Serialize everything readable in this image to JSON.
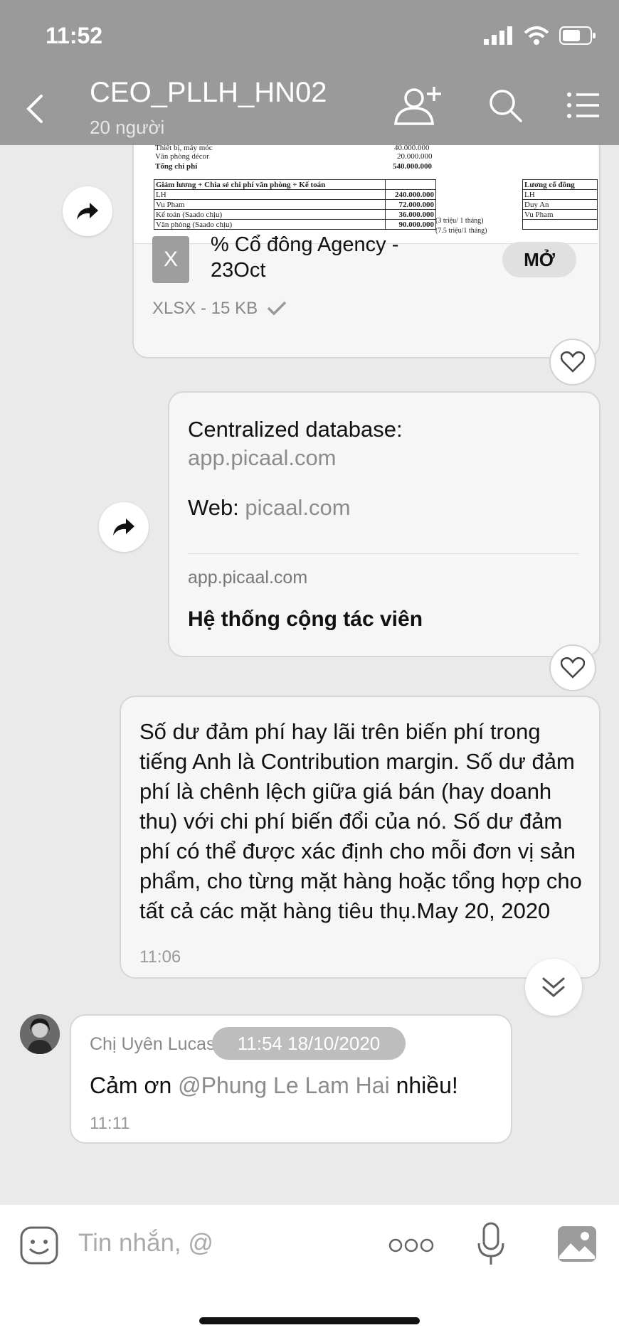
{
  "status": {
    "time": "11:52"
  },
  "header": {
    "title": "CEO_PLLH_HN02",
    "subtitle": "20 người"
  },
  "sheet": {
    "row_top1_label": "Thiết bị, máy móc",
    "row_top1_value": "40.000.000",
    "row_top2_label": "Văn phòng décor",
    "row_top2_value": "20.000.000",
    "row_total_label": "Tổng chi phí",
    "row_total_value": "540.000.000",
    "table1": {
      "header": "Giảm lương + Chia sẻ chi phí văn phòng + Kế toán",
      "rows": [
        {
          "label": "LH",
          "value": "240.000.000",
          "note": ""
        },
        {
          "label": "Vu Pham",
          "value": "72.000.000",
          "note": ""
        },
        {
          "label": "Kế toán (Saado chịu)",
          "value": "36.000.000",
          "note": "(3 triệu/ 1 tháng)"
        },
        {
          "label": "Văn phòng (Saado chịu)",
          "value": "90.000.000",
          "note": "(7.5 triệu/1 tháng)"
        }
      ]
    },
    "table2": {
      "header": "Lương cổ đông",
      "rows": [
        "LH",
        "Duy An",
        "Vu Pham",
        ""
      ]
    }
  },
  "file_message": {
    "filename": "% Cổ đông Agency - 23Oct",
    "file_icon_letter": "X",
    "meta": "XLSX - 15 KB",
    "open_label": "MỞ"
  },
  "link_message": {
    "line1_label": "Centralized database:",
    "line1_link": "app.picaal.com",
    "line2_label": "Web: ",
    "line2_link": "picaal.com",
    "preview_domain": "app.picaal.com",
    "preview_title": "Hệ thống cộng tác viên"
  },
  "text_message": {
    "text": "Số dư đảm phí hay lãi trên biến phí trong tiếng Anh là Contribution margin. Số dư đảm phí là chênh lệch giữa giá bán (hay doanh thu) với chi phí biến đổi của nó. Số dư đảm phí có thể được xác định cho mỗi đơn vị sản phẩm, cho từng mặt hàng hoặc tổng hợp cho tất cả các mặt hàng tiêu thụ.May 20, 2020",
    "time": "11:06"
  },
  "reply_message": {
    "sender": "Chị Uyên Lucas",
    "text_before": "Cảm ơn ",
    "mention": "@Phung Le Lam Hai",
    "text_after": " nhiều!",
    "time": "11:11"
  },
  "date_separator": "11:54 18/10/2020",
  "composer": {
    "placeholder": "Tin nhắn, @"
  },
  "icons": {
    "back": "chevron-left-icon",
    "add_member": "add-user-icon",
    "search": "search-icon",
    "menu": "list-menu-icon",
    "share": "share-forward-icon",
    "heart": "heart-icon",
    "scroll_down": "double-chevron-down-icon",
    "emoji": "sticker-emoji-icon",
    "more": "more-dots-icon",
    "mic": "microphone-icon",
    "image": "image-icon"
  },
  "colors": {
    "header_bg": "#9a9a9a",
    "bubble_bg": "#f6f6f6",
    "link": "#8c8c8c"
  }
}
